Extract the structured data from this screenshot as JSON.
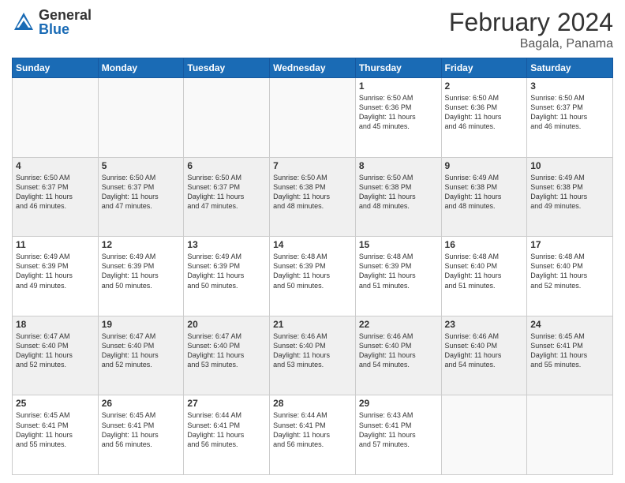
{
  "header": {
    "logo_general": "General",
    "logo_blue": "Blue",
    "month_title": "February 2024",
    "location": "Bagala, Panama"
  },
  "days_of_week": [
    "Sunday",
    "Monday",
    "Tuesday",
    "Wednesday",
    "Thursday",
    "Friday",
    "Saturday"
  ],
  "weeks": [
    {
      "shaded": false,
      "days": [
        {
          "num": "",
          "info": ""
        },
        {
          "num": "",
          "info": ""
        },
        {
          "num": "",
          "info": ""
        },
        {
          "num": "",
          "info": ""
        },
        {
          "num": "1",
          "info": "Sunrise: 6:50 AM\nSunset: 6:36 PM\nDaylight: 11 hours\nand 45 minutes."
        },
        {
          "num": "2",
          "info": "Sunrise: 6:50 AM\nSunset: 6:36 PM\nDaylight: 11 hours\nand 46 minutes."
        },
        {
          "num": "3",
          "info": "Sunrise: 6:50 AM\nSunset: 6:37 PM\nDaylight: 11 hours\nand 46 minutes."
        }
      ]
    },
    {
      "shaded": true,
      "days": [
        {
          "num": "4",
          "info": "Sunrise: 6:50 AM\nSunset: 6:37 PM\nDaylight: 11 hours\nand 46 minutes."
        },
        {
          "num": "5",
          "info": "Sunrise: 6:50 AM\nSunset: 6:37 PM\nDaylight: 11 hours\nand 47 minutes."
        },
        {
          "num": "6",
          "info": "Sunrise: 6:50 AM\nSunset: 6:37 PM\nDaylight: 11 hours\nand 47 minutes."
        },
        {
          "num": "7",
          "info": "Sunrise: 6:50 AM\nSunset: 6:38 PM\nDaylight: 11 hours\nand 48 minutes."
        },
        {
          "num": "8",
          "info": "Sunrise: 6:50 AM\nSunset: 6:38 PM\nDaylight: 11 hours\nand 48 minutes."
        },
        {
          "num": "9",
          "info": "Sunrise: 6:49 AM\nSunset: 6:38 PM\nDaylight: 11 hours\nand 48 minutes."
        },
        {
          "num": "10",
          "info": "Sunrise: 6:49 AM\nSunset: 6:38 PM\nDaylight: 11 hours\nand 49 minutes."
        }
      ]
    },
    {
      "shaded": false,
      "days": [
        {
          "num": "11",
          "info": "Sunrise: 6:49 AM\nSunset: 6:39 PM\nDaylight: 11 hours\nand 49 minutes."
        },
        {
          "num": "12",
          "info": "Sunrise: 6:49 AM\nSunset: 6:39 PM\nDaylight: 11 hours\nand 50 minutes."
        },
        {
          "num": "13",
          "info": "Sunrise: 6:49 AM\nSunset: 6:39 PM\nDaylight: 11 hours\nand 50 minutes."
        },
        {
          "num": "14",
          "info": "Sunrise: 6:48 AM\nSunset: 6:39 PM\nDaylight: 11 hours\nand 50 minutes."
        },
        {
          "num": "15",
          "info": "Sunrise: 6:48 AM\nSunset: 6:39 PM\nDaylight: 11 hours\nand 51 minutes."
        },
        {
          "num": "16",
          "info": "Sunrise: 6:48 AM\nSunset: 6:40 PM\nDaylight: 11 hours\nand 51 minutes."
        },
        {
          "num": "17",
          "info": "Sunrise: 6:48 AM\nSunset: 6:40 PM\nDaylight: 11 hours\nand 52 minutes."
        }
      ]
    },
    {
      "shaded": true,
      "days": [
        {
          "num": "18",
          "info": "Sunrise: 6:47 AM\nSunset: 6:40 PM\nDaylight: 11 hours\nand 52 minutes."
        },
        {
          "num": "19",
          "info": "Sunrise: 6:47 AM\nSunset: 6:40 PM\nDaylight: 11 hours\nand 52 minutes."
        },
        {
          "num": "20",
          "info": "Sunrise: 6:47 AM\nSunset: 6:40 PM\nDaylight: 11 hours\nand 53 minutes."
        },
        {
          "num": "21",
          "info": "Sunrise: 6:46 AM\nSunset: 6:40 PM\nDaylight: 11 hours\nand 53 minutes."
        },
        {
          "num": "22",
          "info": "Sunrise: 6:46 AM\nSunset: 6:40 PM\nDaylight: 11 hours\nand 54 minutes."
        },
        {
          "num": "23",
          "info": "Sunrise: 6:46 AM\nSunset: 6:40 PM\nDaylight: 11 hours\nand 54 minutes."
        },
        {
          "num": "24",
          "info": "Sunrise: 6:45 AM\nSunset: 6:41 PM\nDaylight: 11 hours\nand 55 minutes."
        }
      ]
    },
    {
      "shaded": false,
      "days": [
        {
          "num": "25",
          "info": "Sunrise: 6:45 AM\nSunset: 6:41 PM\nDaylight: 11 hours\nand 55 minutes."
        },
        {
          "num": "26",
          "info": "Sunrise: 6:45 AM\nSunset: 6:41 PM\nDaylight: 11 hours\nand 56 minutes."
        },
        {
          "num": "27",
          "info": "Sunrise: 6:44 AM\nSunset: 6:41 PM\nDaylight: 11 hours\nand 56 minutes."
        },
        {
          "num": "28",
          "info": "Sunrise: 6:44 AM\nSunset: 6:41 PM\nDaylight: 11 hours\nand 56 minutes."
        },
        {
          "num": "29",
          "info": "Sunrise: 6:43 AM\nSunset: 6:41 PM\nDaylight: 11 hours\nand 57 minutes."
        },
        {
          "num": "",
          "info": ""
        },
        {
          "num": "",
          "info": ""
        }
      ]
    }
  ]
}
